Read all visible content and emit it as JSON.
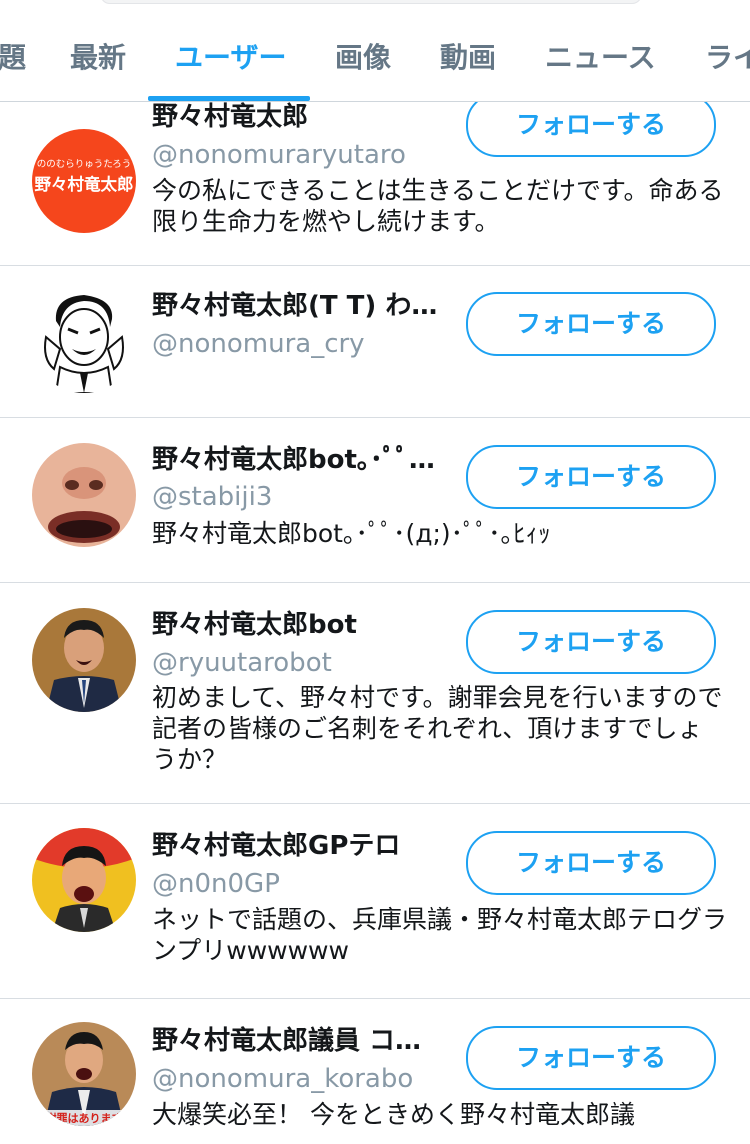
{
  "tabs": [
    {
      "label": "題"
    },
    {
      "label": "最新"
    },
    {
      "label": "ユーザー",
      "active": true
    },
    {
      "label": "画像"
    },
    {
      "label": "動画"
    },
    {
      "label": "ニュース"
    },
    {
      "label": "ライ"
    }
  ],
  "follow_label": "フォローする",
  "users": [
    {
      "name": "野々村竜太郎",
      "handle": "@nonomuraryutaro",
      "bio": "今の私にできることは生きることだけです。命ある限り生命力を燃やし続けます。",
      "avatar_text_small": "ののむらりゅうたろう",
      "avatar_text": "野々村竜太郎"
    },
    {
      "name": "野々村竜太郎(T T) わ…",
      "handle": "@nonomura_cry",
      "bio": ""
    },
    {
      "name": "野々村竜太郎bot｡･ﾟﾟ…",
      "handle": "@stabiji3",
      "bio": "野々村竜太郎bot｡･ﾟﾟ･(д;)･ﾟﾟ･｡ﾋｨｯ"
    },
    {
      "name": "野々村竜太郎bot",
      "handle": "@ryuutarobot",
      "bio": "初めまして、野々村です。謝罪会見を行いますので記者の皆様のご名刺をそれぞれ、頂けますでしょうか？"
    },
    {
      "name": "野々村竜太郎GPテロ",
      "handle": "@n0n0GP",
      "bio": "ネットで話題の、兵庫県議・野々村竜太郎テログランプリwwwwww"
    },
    {
      "name": "野々村竜太郎議員 コ…",
      "handle": "@nonomura_korabo",
      "bio": "大爆笑必至！ 今をときめく野々村竜太郎議",
      "avatar_caption": "謝罪はあります"
    }
  ],
  "colors": {
    "accent": "#1da1f2",
    "secondary_text": "#8899a6",
    "tab_text": "#657786",
    "divider": "#d8dde2",
    "avatar1_bg": "#f5461c"
  }
}
